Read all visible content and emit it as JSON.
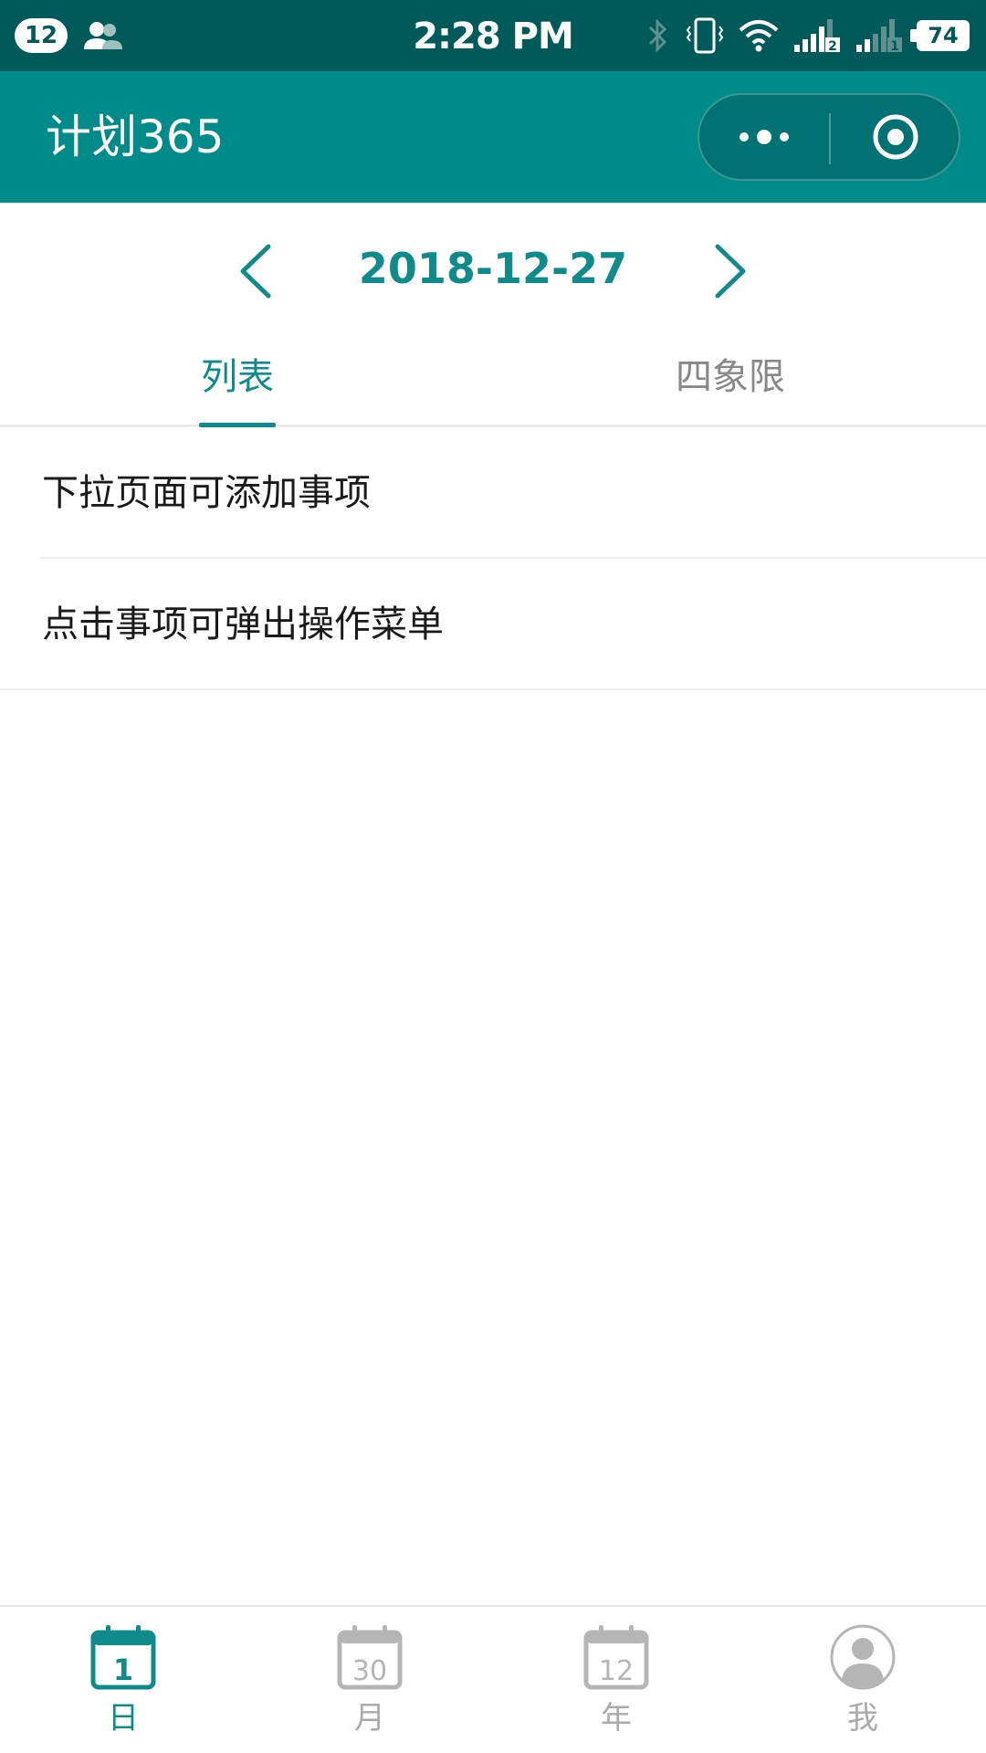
{
  "status_bar": {
    "notification_count": "12",
    "time": "2:28 PM",
    "battery": "74"
  },
  "navbar": {
    "title": "计划365"
  },
  "date_nav": {
    "date": "2018-12-27"
  },
  "tabs": [
    {
      "label": "列表",
      "active": true
    },
    {
      "label": "四象限",
      "active": false
    }
  ],
  "list": {
    "items": [
      {
        "text": "下拉页面可添加事项"
      },
      {
        "text": "点击事项可弹出操作菜单"
      }
    ]
  },
  "tabbar": {
    "items": [
      {
        "label": "日",
        "icon": "calendar-day-icon",
        "icon_text": "1",
        "active": true
      },
      {
        "label": "月",
        "icon": "calendar-month-icon",
        "icon_text": "30",
        "active": false
      },
      {
        "label": "年",
        "icon": "calendar-year-icon",
        "icon_text": "12",
        "active": false
      },
      {
        "label": "我",
        "icon": "user-avatar-icon",
        "active": false
      }
    ]
  },
  "colors": {
    "primary": "#008b8b",
    "status_bar": "#005a5a",
    "accent_text": "#108b8b",
    "inactive": "#aaaaaa"
  }
}
